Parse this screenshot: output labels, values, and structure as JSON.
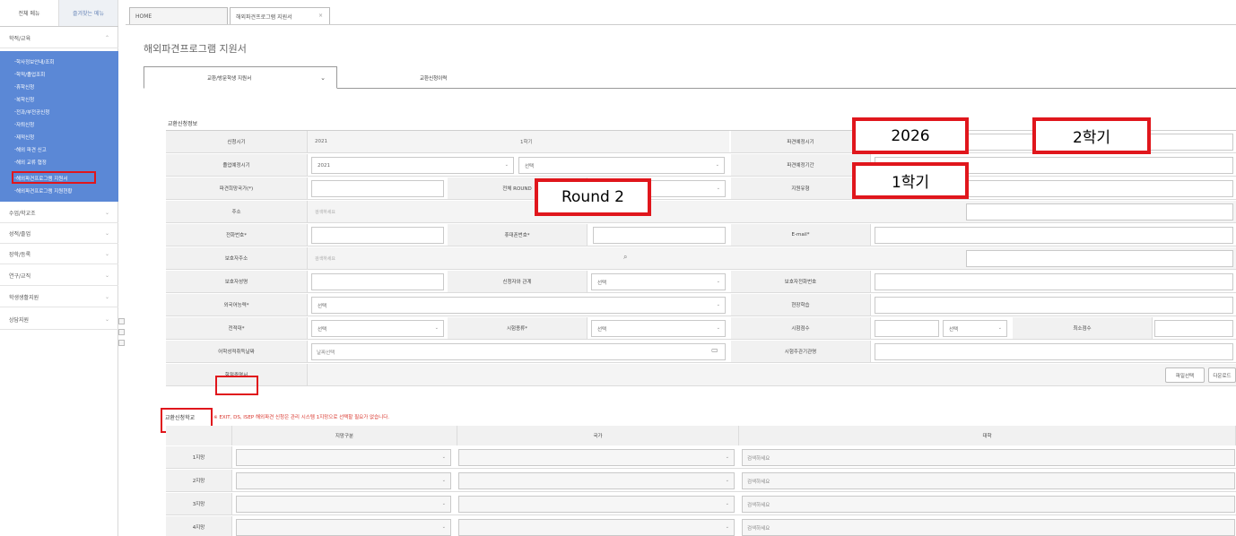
{
  "sidebar": {
    "tabs": [
      "전체 메뉴",
      "즐겨찾는 메뉴"
    ],
    "sections": [
      "학적/교육",
      "수업/학교조",
      "성적/졸업",
      "장학/등록",
      "연구/교직",
      "학생생활지원",
      "상담지원"
    ],
    "sub_items": [
      "학사정보안내/조회",
      "학적/졸업조회",
      "휴학신청",
      "복학신청",
      "전과/부전공신청",
      "자퇴신청",
      "제적신청",
      "해외 파견 신고",
      "해외 교류 협정",
      "해외파견프로그램 지원서",
      "해외파견프로그램 지원현황"
    ],
    "highlighted_item": "해외파견프로그램 지원서"
  },
  "top_tabs": [
    "HOME",
    "해외파견프로그램 지원서"
  ],
  "page_title": "해외파견프로그램 지원서",
  "inner_tabs": [
    "교환/방문학생 지원서",
    "교환신청이력"
  ],
  "form": {
    "section_label": "교환신청정보",
    "rows": [
      {
        "l1": "신청시기",
        "v1a": "2021",
        "v1b": "1학기",
        "l3": "파견예정시기"
      },
      {
        "l1": "졸업예정시기",
        "v1a": "2021",
        "v1b": "선택",
        "l3": "파견예정기간"
      },
      {
        "l1": "파견희망국가(*)",
        "l2": "전체 ROUND",
        "l3": "지원유형"
      },
      {
        "l1": "주소",
        "ph": "검색하세요"
      },
      {
        "l1": "전화번호*",
        "l2": "휴대폰번호*",
        "l3": "E-mail*"
      },
      {
        "l1": "보호자주소",
        "ph": "검색하세요"
      },
      {
        "l1": "보호자성명",
        "l2": "신청자와 관계",
        "s2": "선택",
        "l3": "보호자전화번호"
      },
      {
        "l1": "외국어능력*",
        "s1": "선택",
        "l3": "현장학습"
      },
      {
        "l1": "전적대*",
        "s1": "선택",
        "l2": "시험종류*",
        "s2": "선택",
        "l3": "시험점수",
        "s3": "선택",
        "l4": "최소점수"
      },
      {
        "l1": "어학성적취득날짜",
        "ph": "날짜선택",
        "l3": "시험주관기관명"
      },
      {
        "l1": "학점증명서"
      }
    ],
    "buttons": [
      "파일선택",
      "다운로드"
    ]
  },
  "bottom": {
    "section_label": "교환신청학교",
    "note": "※ EXIT, DS, ISEP 해외파견 신청은 관리 시스템 1지망으로 선택할 필요가 없습니다.",
    "headers": [
      "지망구분",
      "국가",
      "대학"
    ],
    "rows": [
      "1지망",
      "2지망",
      "3지망",
      "4지망"
    ],
    "univ_placeholder": "검색하세요"
  },
  "callouts": {
    "year": "2026",
    "semester_right": "2학기",
    "semester_left": "1학기",
    "round": "Round  2"
  },
  "colors": {
    "sidebar_blue": "#5b88d6",
    "highlight_red": "#e0161c"
  }
}
